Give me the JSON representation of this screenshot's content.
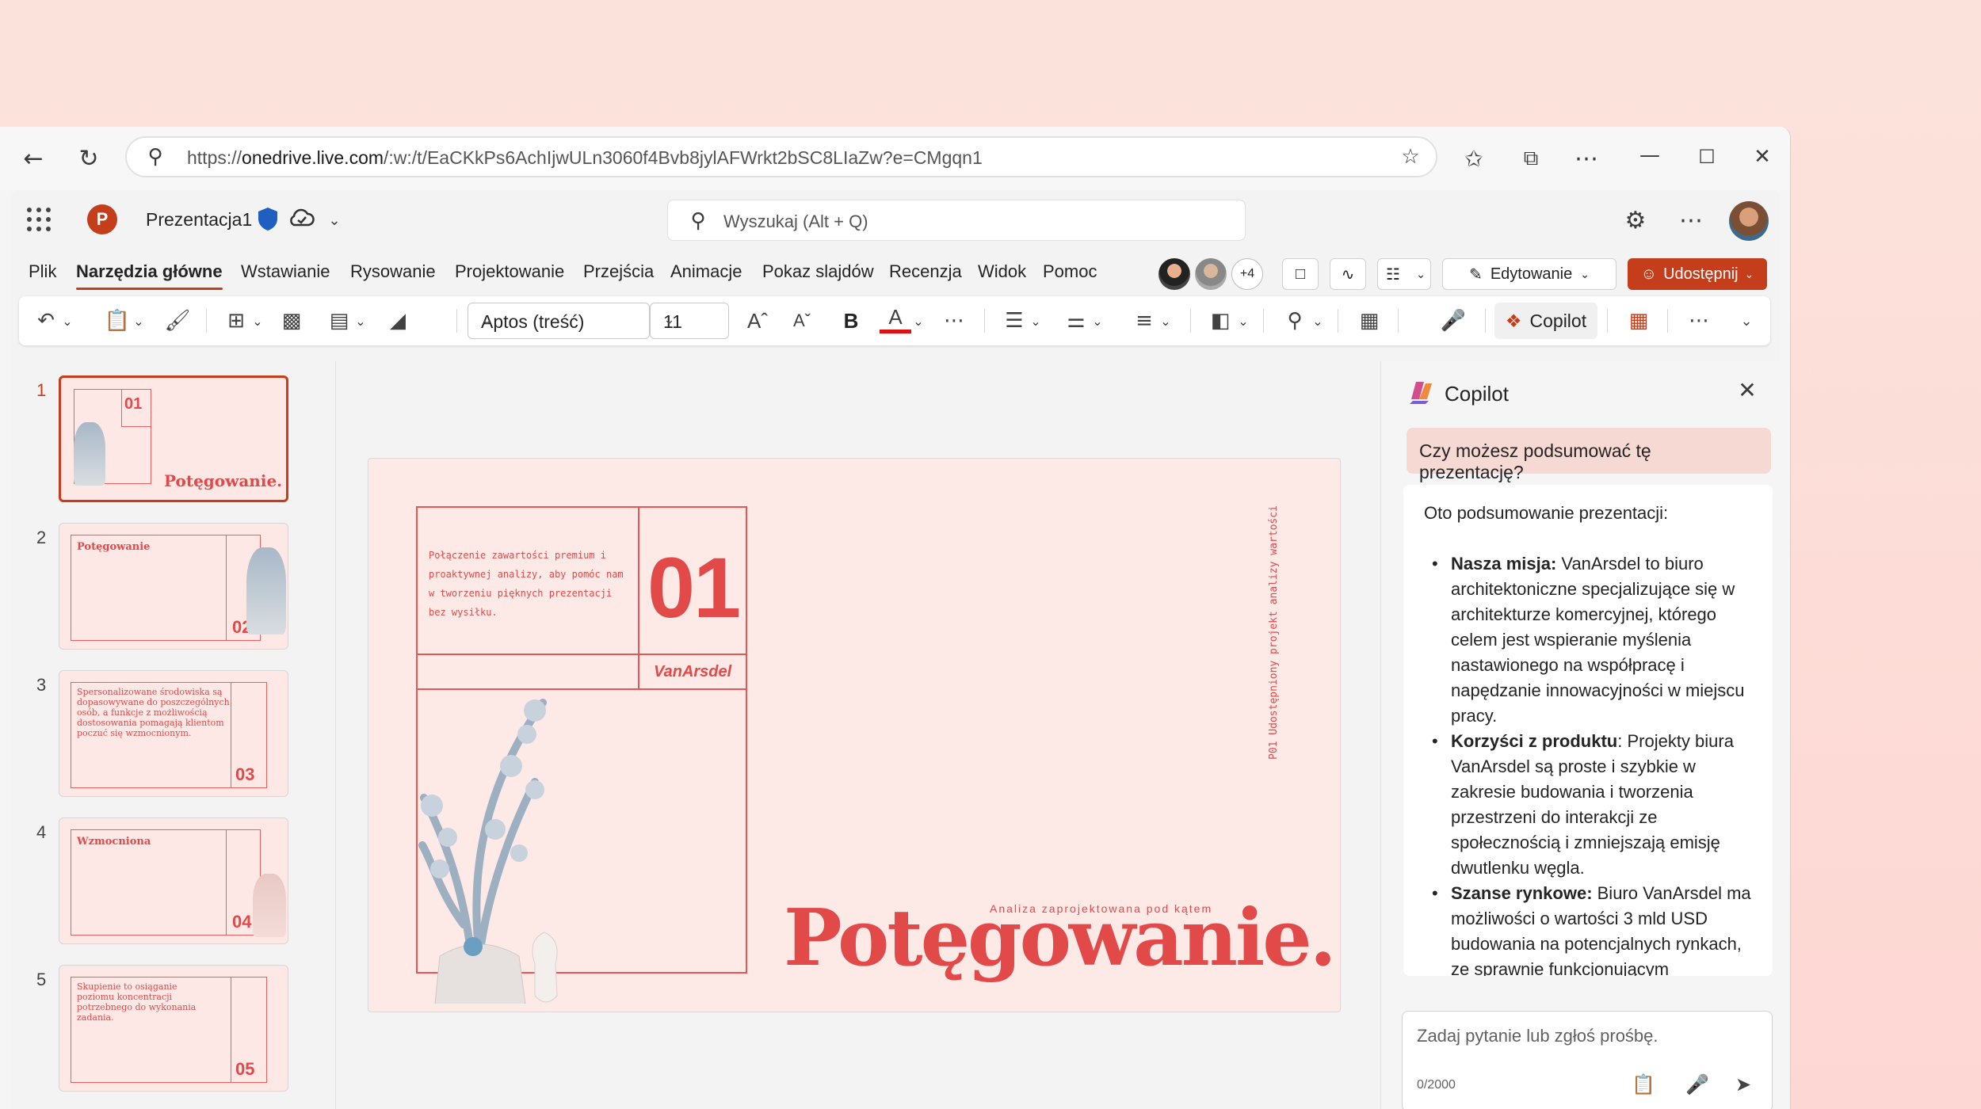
{
  "browser": {
    "url_prefix": "https://",
    "url_domain": "onedrive.live.com",
    "url_rest": "/:w:/t/EaCKkPs6AchIjwULn3060f4Bvb8jylAFWrkt2bSC8LIaZw?e=CMgqn1"
  },
  "app": {
    "logo_letter": "P",
    "doc_title": "Prezentacja1",
    "search_placeholder": "Wyszukaj (Alt + Q)",
    "collab_more": "+4"
  },
  "tabs": [
    "Plik",
    "Narzędzia główne",
    "Wstawianie",
    "Rysowanie",
    "Projektowanie",
    "Przejścia",
    "Animacje",
    "Pokaz slajdów",
    "Recenzja",
    "Widok",
    "Pomoc"
  ],
  "ribbon": {
    "editing_label": "Edytowanie",
    "share_label": "Udostępnij",
    "font_name": "Aptos (treść)",
    "font_size": "11",
    "copilot_label": "Copilot"
  },
  "thumbnails": [
    {
      "num": "1",
      "title": "Potęgowanie.",
      "badge": "01"
    },
    {
      "num": "2",
      "title": "Potęgowanie",
      "badge": "02"
    },
    {
      "num": "3",
      "title": "Spersonalizowane środowiska są dopasowywane do poszczególnych osób, a funkcje z możliwością dostosowania pomagają klientom poczuć się wzmocnionym.",
      "badge": "03"
    },
    {
      "num": "4",
      "title": "Wzmocniona",
      "badge": "04"
    },
    {
      "num": "5",
      "title": "Skupienie to osiąganie poziomu koncentracji potrzebnego do wykonania zadania.",
      "badge": "05"
    }
  ],
  "slide": {
    "intro_text": "Połączenie zawartości premium i proaktywnej analizy, aby pomóc nam w tworzeniu pięknych prezentacji bez wysiłku.",
    "number": "01",
    "brand": "VanArsdel",
    "subtitle": "Analiza zaprojektowana pod kątem",
    "title": "Potęgowanie.",
    "vertical_text": "P01   Udostępniony projekt analizy wartości"
  },
  "copilot": {
    "title": "Copilot",
    "question": "Czy możesz podsumować tę prezentację?",
    "answer_intro": "Oto podsumowanie prezentacji:",
    "bullets": [
      {
        "bold": "Nasza misja:",
        "text": " VanArsdel to biuro architektoniczne specjalizujące się w architekturze komercyjnej, którego celem jest wspieranie myślenia nastawionego na współpracę i napędzanie innowacyjności w miejscu pracy."
      },
      {
        "bold": "Korzyści z produktu",
        "text": ": Projekty biura VanArsdel są proste i szybkie w zakresie budowania i tworzenia przestrzeni do interakcji ze społecznością i zmniejszają emisję dwutlenku węgla."
      },
      {
        "bold": "Szanse rynkowe:",
        "text": " Biuro VanArsdel ma możliwości o wartości 3 mld USD budowania na potencjalnych rynkach, ze sprawnie funkcjonującym"
      }
    ],
    "input_placeholder": "Zadaj pytanie lub zgłoś prośbę.",
    "char_count": "0/2000"
  },
  "colors": {
    "accent": "#c43e1c",
    "slide_red": "#e24a4a",
    "slide_bg": "#fde9e6"
  }
}
